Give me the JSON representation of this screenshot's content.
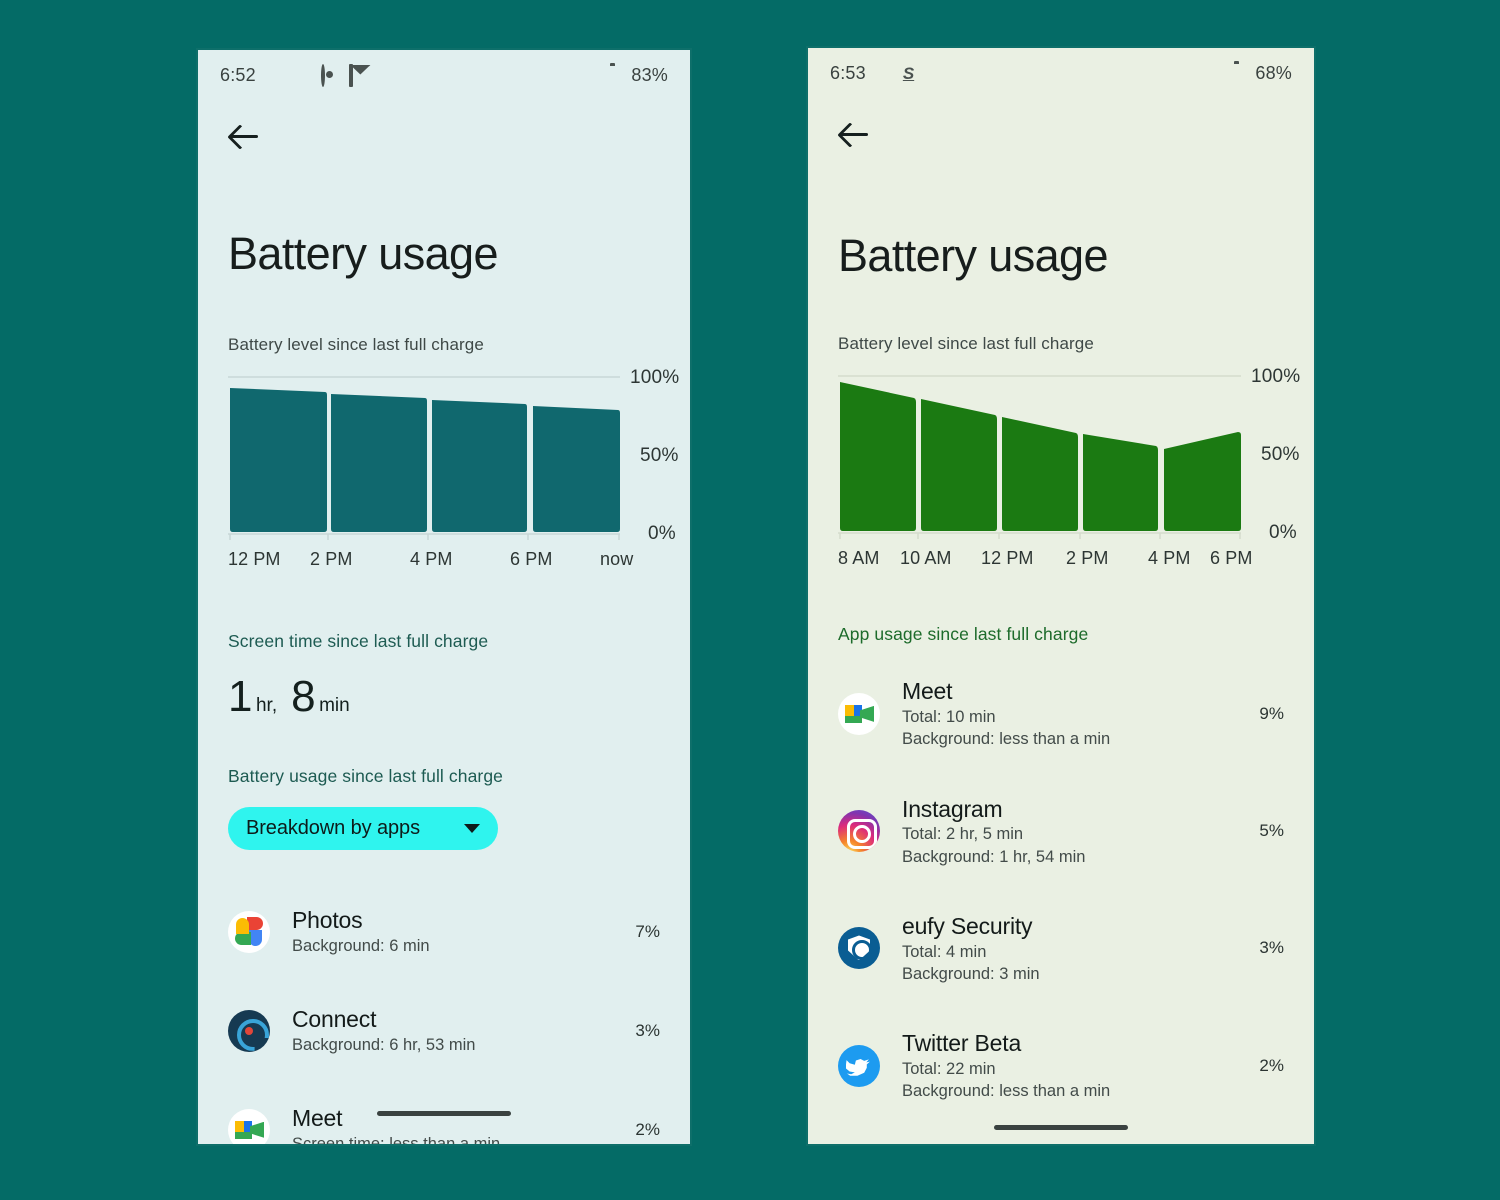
{
  "page": {
    "background_color": "#046b66"
  },
  "phones": [
    {
      "id": "left",
      "screen_background": "#e1efef",
      "accent_color": "#10686e",
      "status_bar": {
        "time": "6:52",
        "battery_percent": "83%",
        "left_icons": [
          "hand-icon",
          "bee-icon",
          "ring-icon",
          "gmail-icon",
          "dot-icon"
        ],
        "right_icons": [
          "wifi-icon",
          "battery-icon"
        ]
      },
      "back_label": "back-arrow",
      "title": "Battery usage",
      "chart_label": "Battery level since last full charge",
      "y_ticks": [
        "100%",
        "50%",
        "0%"
      ],
      "x_ticks": [
        "12 PM",
        "2 PM",
        "4 PM",
        "6 PM",
        "now"
      ],
      "screen_time": {
        "label": "Screen time since last full charge",
        "hours_value": "1",
        "hours_unit": "hr,",
        "minutes_value": "8",
        "minutes_unit": "min"
      },
      "usage_label": "Battery usage since last full charge",
      "dropdown": {
        "selected": "Breakdown by apps",
        "color": "#2ff4ee"
      },
      "apps": [
        {
          "icon": "photos-icon",
          "name": "Photos",
          "lines": [
            "Background: 6 min"
          ],
          "percent": "7%"
        },
        {
          "icon": "connect-icon",
          "name": "Connect",
          "lines": [
            "Background: 6 hr, 53 min"
          ],
          "percent": "3%"
        },
        {
          "icon": "meet-icon",
          "name": "Meet",
          "lines": [
            "Screen time: less than a min"
          ],
          "percent": "2%"
        }
      ]
    },
    {
      "id": "right",
      "screen_background": "#eaf0e3",
      "accent_color": "#1b7a12",
      "status_bar": {
        "time": "6:53",
        "battery_percent": "68%",
        "left_icons": [
          "shield-icon",
          "s-icon",
          "globe-icon"
        ],
        "right_icons": [
          "wifi-icon",
          "signal-icon",
          "battery-icon"
        ]
      },
      "back_label": "back-arrow",
      "title": "Battery usage",
      "chart_label": "Battery level since last full charge",
      "y_ticks": [
        "100%",
        "50%",
        "0%"
      ],
      "x_ticks": [
        "8 AM",
        "10 AM",
        "12 PM",
        "2 PM",
        "4 PM",
        "6 PM"
      ],
      "apps_label": "App usage since last full charge",
      "apps": [
        {
          "icon": "meet-icon",
          "name": "Meet",
          "lines": [
            "Total: 10 min",
            "Background: less than a min"
          ],
          "percent": "9%"
        },
        {
          "icon": "instagram-icon",
          "name": "Instagram",
          "lines": [
            "Total: 2 hr, 5 min",
            "Background: 1 hr, 54 min"
          ],
          "percent": "5%"
        },
        {
          "icon": "eufy-icon",
          "name": "eufy Security",
          "lines": [
            "Total: 4 min",
            "Background: 3 min"
          ],
          "percent": "3%"
        },
        {
          "icon": "twitter-icon",
          "name": "Twitter Beta",
          "lines": [
            "Total: 22 min",
            "Background: less than a min"
          ],
          "percent": "2%"
        }
      ]
    }
  ],
  "chart_data": [
    {
      "type": "area",
      "id": "left-battery-chart",
      "title": "Battery level since last full charge",
      "xlabel": "",
      "ylabel": "Battery level",
      "ylim": [
        0,
        100
      ],
      "grid": false,
      "legend": "none",
      "color": "#10686e",
      "x_tick_labels": [
        "12 PM",
        "2 PM",
        "4 PM",
        "6 PM",
        "now"
      ],
      "y_tick_labels": [
        "0%",
        "50%",
        "100%"
      ],
      "segments": [
        {
          "start_label": "12 PM",
          "end_label": "2 PM",
          "start_value": 96,
          "end_value": 92
        },
        {
          "start_label": "2 PM",
          "end_label": "4 PM",
          "start_value": 92,
          "end_value": 88
        },
        {
          "start_label": "4 PM",
          "end_label": "6 PM",
          "start_value": 89,
          "end_value": 85
        },
        {
          "start_label": "6 PM",
          "end_label": "now",
          "start_value": 85,
          "end_value": 83
        }
      ]
    },
    {
      "type": "area",
      "id": "right-battery-chart",
      "title": "Battery level since last full charge",
      "xlabel": "",
      "ylabel": "Battery level",
      "ylim": [
        0,
        100
      ],
      "grid": false,
      "legend": "none",
      "color": "#1b7a12",
      "x_tick_labels": [
        "8 AM",
        "10 AM",
        "12 PM",
        "2 PM",
        "4 PM",
        "6 PM"
      ],
      "y_tick_labels": [
        "0%",
        "50%",
        "100%"
      ],
      "segments": [
        {
          "start_label": "8 AM",
          "end_label": "10 AM",
          "start_value": 98,
          "end_value": 88
        },
        {
          "start_label": "10 AM",
          "end_label": "12 PM",
          "start_value": 89,
          "end_value": 79
        },
        {
          "start_label": "12 PM",
          "end_label": "2 PM",
          "start_value": 80,
          "end_value": 70
        },
        {
          "start_label": "2 PM",
          "end_label": "4 PM",
          "start_value": 71,
          "end_value": 64
        },
        {
          "start_label": "4 PM",
          "end_label": "6 PM",
          "start_value": 63,
          "end_value": 72
        }
      ]
    }
  ]
}
